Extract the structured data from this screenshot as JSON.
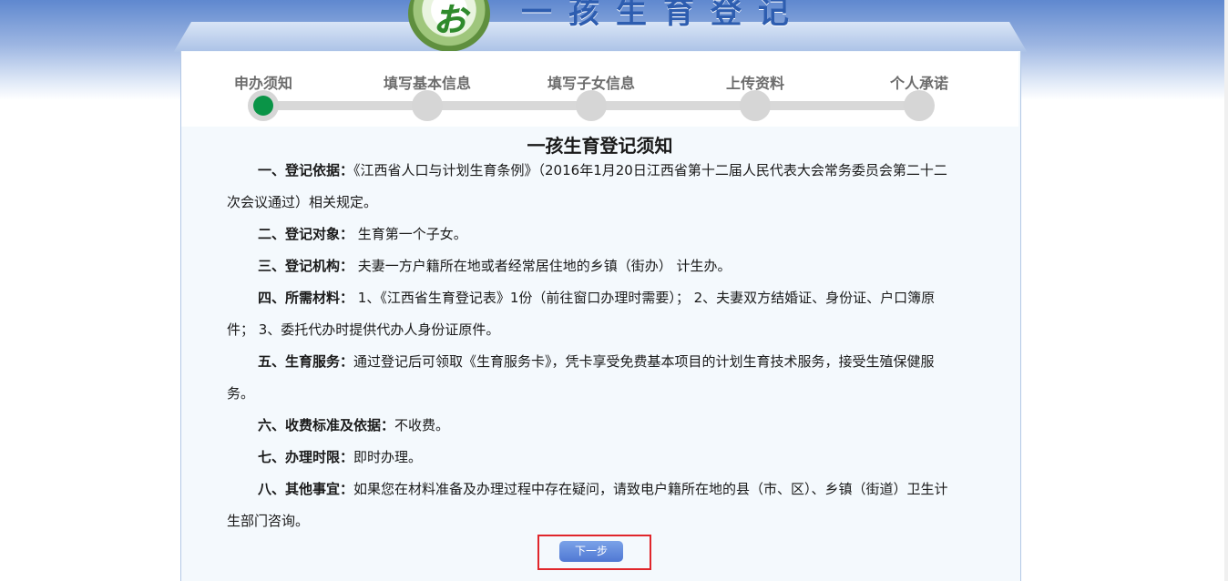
{
  "header": {
    "banner_title": "一孩生育登记",
    "emblem_glyph": "ぉ"
  },
  "steps": [
    {
      "label": "申办须知",
      "active": true
    },
    {
      "label": "填写基本信息",
      "active": false
    },
    {
      "label": "填写子女信息",
      "active": false
    },
    {
      "label": "上传资料",
      "active": false
    },
    {
      "label": "个人承诺",
      "active": false
    }
  ],
  "notice": {
    "title": "一孩生育登记须知",
    "items": [
      {
        "term": "一、登记依据：",
        "text": "《江西省人口与计划生育条例》（2016年1月20日江西省第十二届人民代表大会常务委员会第二十二次会议通过）相关规定。"
      },
      {
        "term": "二、登记对象：",
        "text": " 生育第一个子女。"
      },
      {
        "term": "三、登记机构：",
        "text": " 夫妻一方户籍所在地或者经常居住地的乡镇（街办） 计生办。"
      },
      {
        "term": "四、所需材料：",
        "text": " 1、《江西省生育登记表》1份（前往窗口办理时需要）； 2、夫妻双方结婚证、身份证、户口簿原件； 3、委托代办时提供代办人身份证原件。"
      },
      {
        "term": "五、生育服务：",
        "text": "通过登记后可领取《生育服务卡》，凭卡享受免费基本项目的计划生育技术服务，接受生殖保健服务。"
      },
      {
        "term": "六、收费标准及依据：",
        "text": "不收费。"
      },
      {
        "term": "七、办理时限：",
        "text": "即时办理。"
      },
      {
        "term": "八、其他事宜：",
        "text": "如果您在材料准备及办理过程中存在疑问，请致电户籍所在地的县（市、区）、乡镇（街道）卫生计生部门咨询。"
      }
    ]
  },
  "actions": {
    "next_label": "下一步"
  },
  "colors": {
    "active_step": "#0a9447",
    "inactive_step": "#d6d6d6",
    "button": "#5b82d6",
    "highlight": "#e0262b"
  }
}
